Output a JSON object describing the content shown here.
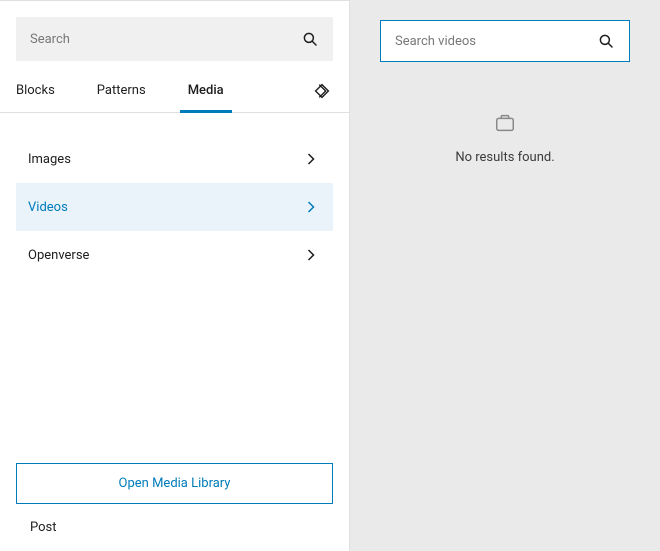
{
  "left": {
    "search": {
      "placeholder": "Search"
    },
    "tabs": {
      "blocks": "Blocks",
      "patterns": "Patterns",
      "media": "Media"
    },
    "media_items": {
      "images": "Images",
      "videos": "Videos",
      "openverse": "Openverse"
    },
    "open_library": "Open Media Library",
    "post": "Post"
  },
  "right": {
    "search": {
      "placeholder": "Search videos"
    },
    "empty": "No results found."
  }
}
